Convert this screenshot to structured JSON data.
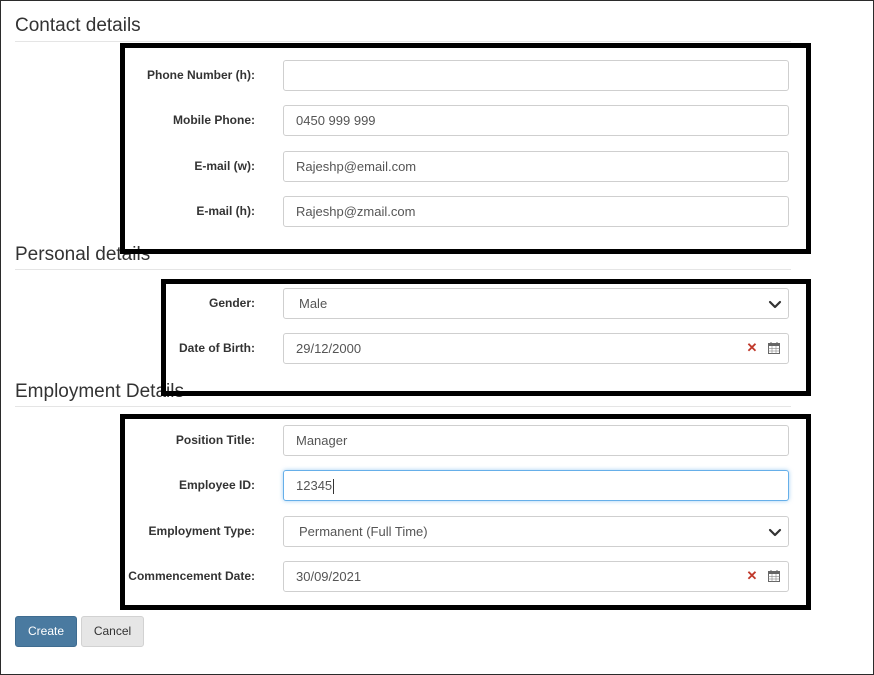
{
  "sections": {
    "contact": "Contact details",
    "personal": "Personal details",
    "employment": "Employment Details"
  },
  "contact": {
    "phone_home": {
      "label": "Phone Number (h):",
      "value": ""
    },
    "mobile": {
      "label": "Mobile Phone:",
      "value": "0450 999 999"
    },
    "email_work": {
      "label": "E-mail (w):",
      "value": "Rajeshp@email.com"
    },
    "email_home": {
      "label": "E-mail (h):",
      "value": "Rajeshp@zmail.com"
    }
  },
  "personal": {
    "gender": {
      "label": "Gender:",
      "value": "Male"
    },
    "dob": {
      "label": "Date of Birth:",
      "value": "29/12/2000"
    }
  },
  "employment": {
    "position": {
      "label": "Position Title:",
      "value": "Manager"
    },
    "employee_id": {
      "label": "Employee ID:",
      "value": "12345"
    },
    "type": {
      "label": "Employment Type:",
      "value": "Permanent (Full Time)"
    },
    "commencement": {
      "label": "Commencement Date:",
      "value": "30/09/2021"
    }
  },
  "buttons": {
    "create": "Create",
    "cancel": "Cancel"
  },
  "colors": {
    "primary": "#4a7aa0",
    "clear_icon": "#c0392b",
    "focus": "#66afe9"
  }
}
